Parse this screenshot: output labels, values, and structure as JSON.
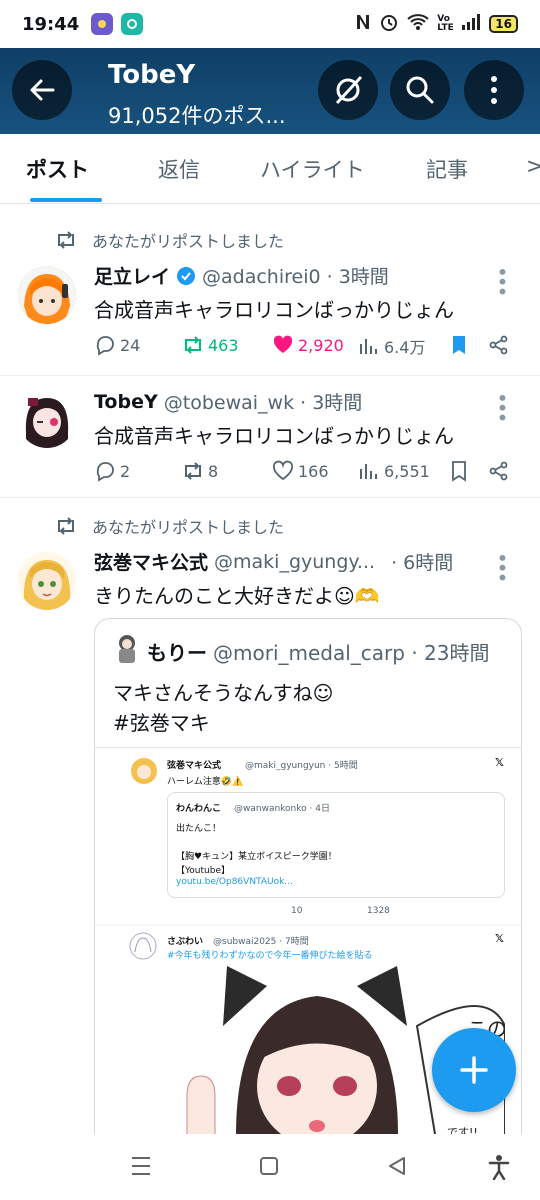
{
  "status_bar": {
    "time": "19:44",
    "battery": "16",
    "network": "Vo LTE"
  },
  "header": {
    "title": "TobeY",
    "subtitle": "91,052件のポス..."
  },
  "tabs": [
    {
      "label": "ポスト",
      "active": true
    },
    {
      "label": "返信"
    },
    {
      "label": "ハイライト"
    },
    {
      "label": "記事"
    },
    {
      "label": ">"
    }
  ],
  "posts": [
    {
      "repost_label": "あなたがリポストしました",
      "name": "足立レイ",
      "handle": "@adachirei0 · 3時間",
      "text": "合成音声キャラロリコンばっかりじょん",
      "replies": "24",
      "reposts": "463",
      "likes": "2,920",
      "views": "6.4万",
      "reposted": true,
      "liked": true,
      "bookmarked": true,
      "verified": true
    },
    {
      "name": "TobeY",
      "handle": "@tobewai_wk · 3時間",
      "text": "合成音声キャラロリコンばっかりじょん",
      "replies": "2",
      "reposts": "8",
      "likes": "166",
      "views": "6,551"
    },
    {
      "repost_label": "あなたがリポストしました",
      "name": "弦巻マキ公式",
      "handle": "@maki_gyungy...",
      "time": "· 6時間",
      "text": "きりたんのこと大好きだよ☺🫶",
      "quote": {
        "name": "もりー",
        "handle": "@mori_medal_carp · 23時間",
        "line1": "マキさんそうなんすね☺",
        "line2": "#弦巻マキ",
        "embedded": {
          "post1_name": "弦巻マキ公式",
          "post1_handle": "@maki_gyungyun · 5時間",
          "post1_text": "ハーレム注意🤣⚠️",
          "inner_name": "わんわんこ",
          "inner_handle": "@wanwankonko · 4日",
          "inner_line1": "出たんこ！",
          "inner_line2": "【胸♥キュン】某立ボイスピーク学園！",
          "inner_line3": "【Youtube】",
          "inner_link": "youtu.be/Op86VNTAUok...",
          "post1_likes": "10",
          "post1_views": "1328",
          "post2_name": "さぶわい",
          "post2_handle": "@subwai2025 · 7時間",
          "post2_text": "#今年も残りわずかなので今年一番伸びた絵を貼る",
          "speech_text": "この人ロリ",
          "speech_text2": "です!!"
        }
      }
    }
  ],
  "colors": {
    "accent": "#1d9bf0",
    "repost": "#00ba7c",
    "like": "#f91880",
    "header": "#12476f"
  }
}
